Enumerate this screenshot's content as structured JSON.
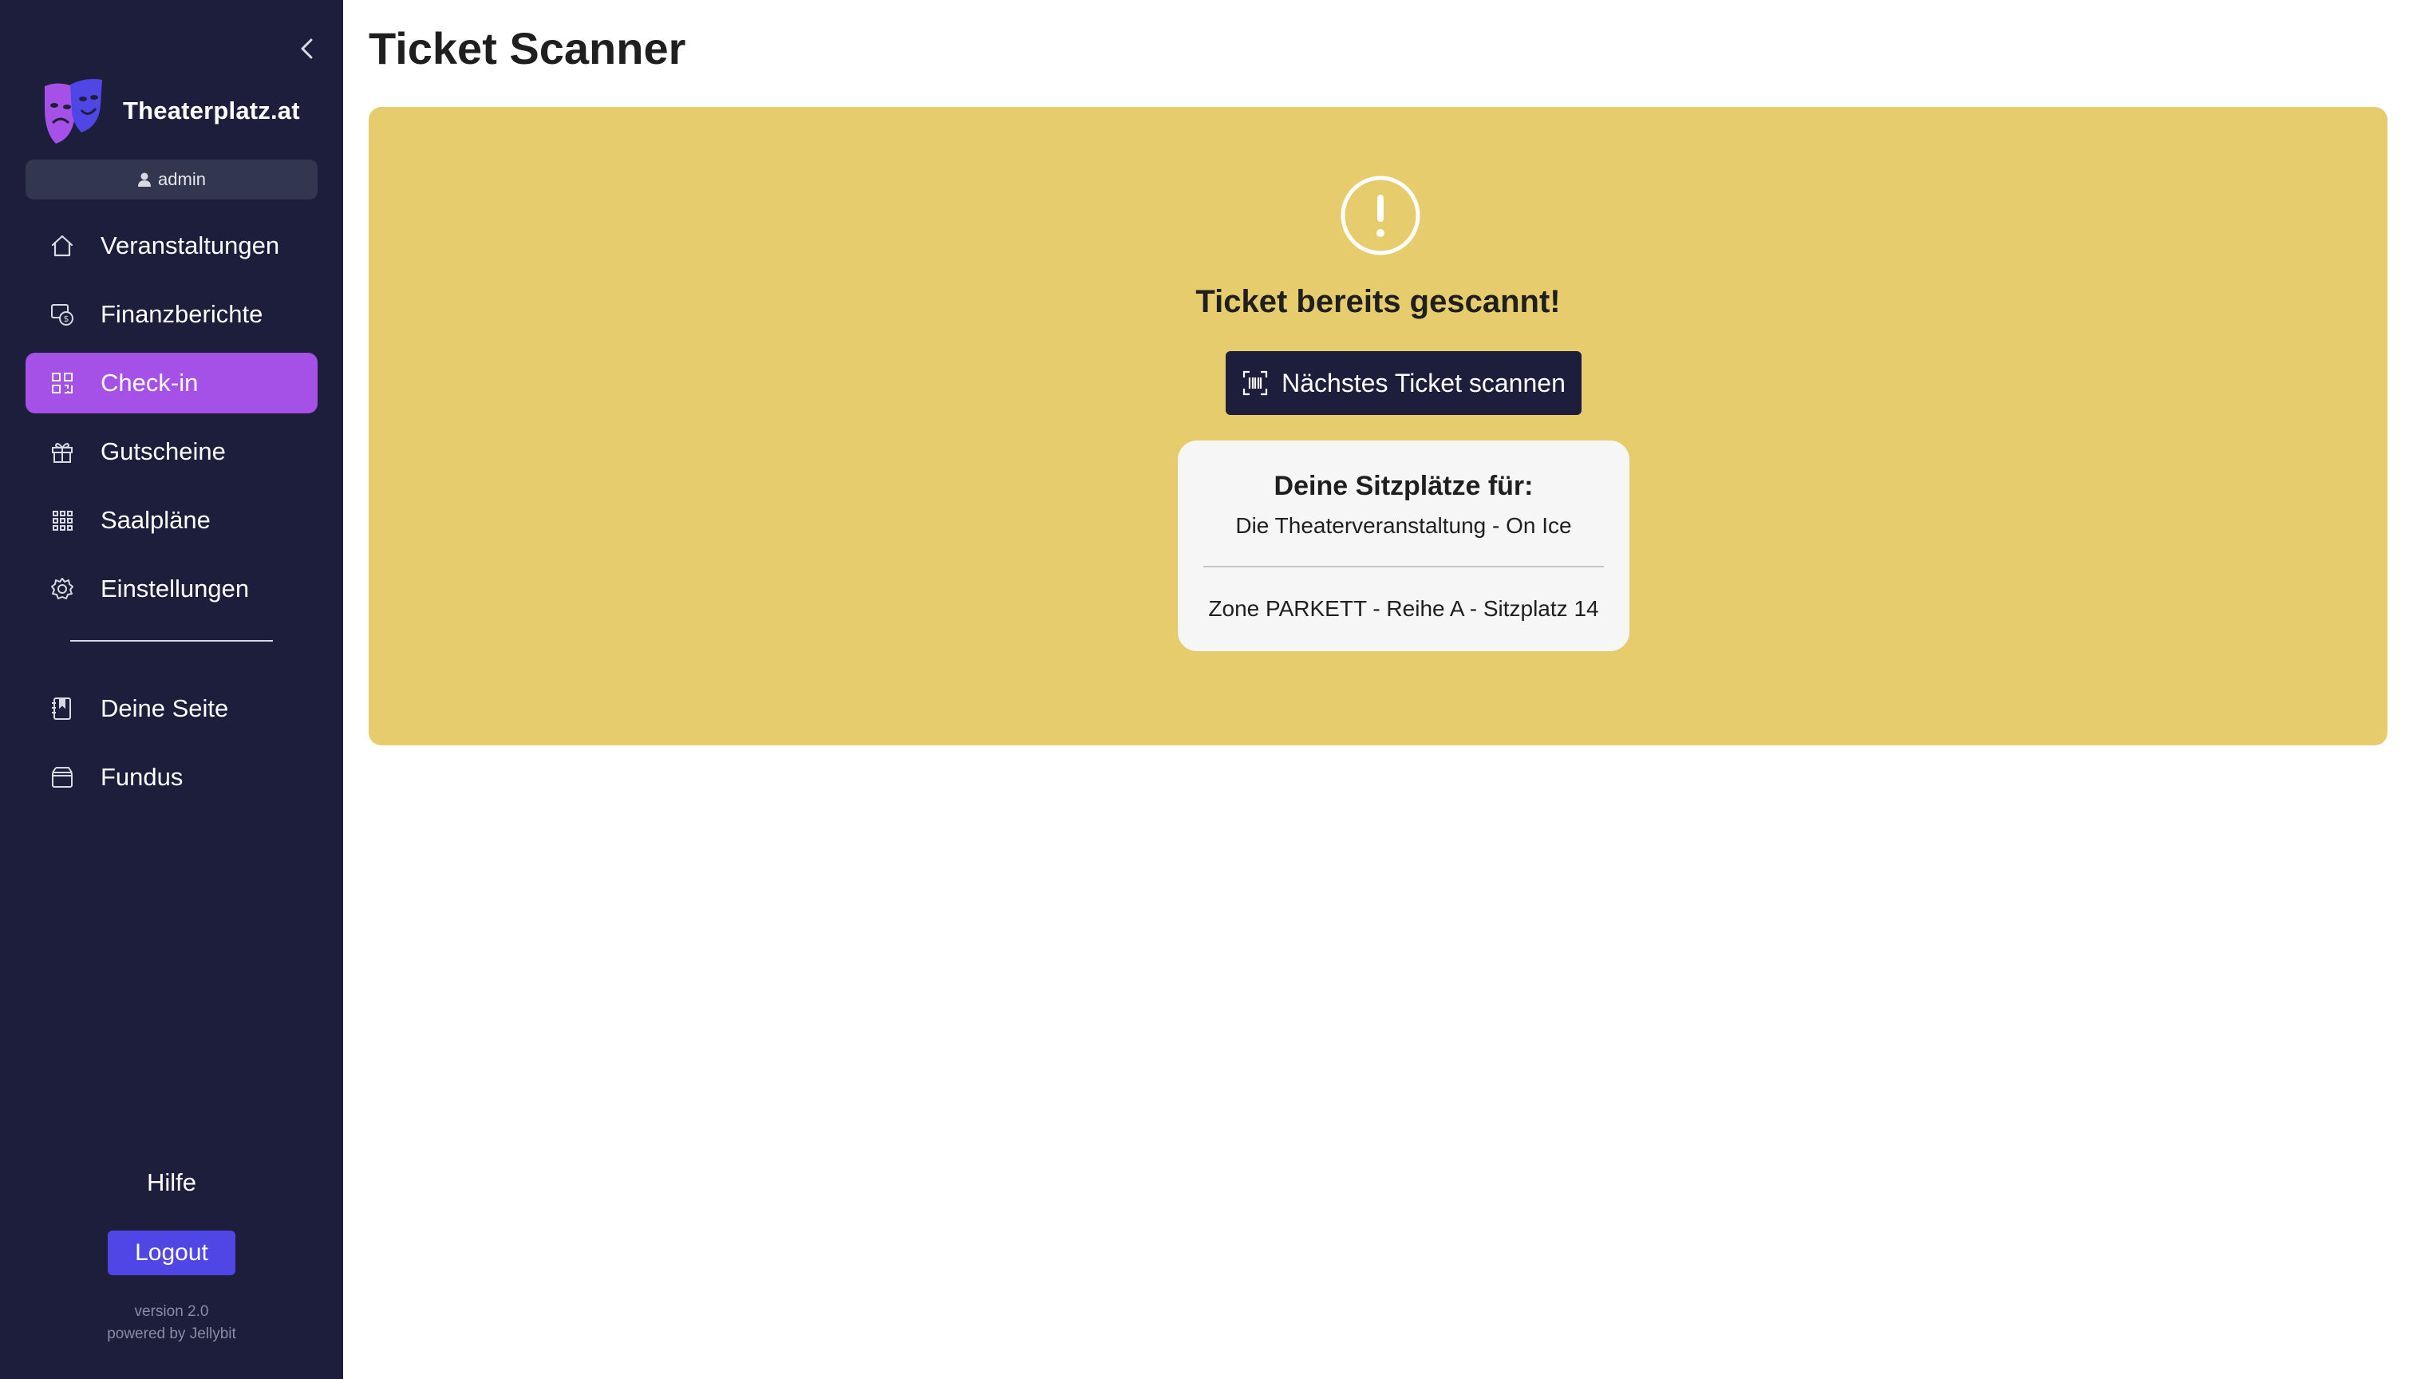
{
  "sidebar": {
    "brand_name": "Theaterplatz.at",
    "user": "admin",
    "nav": [
      {
        "label": "Veranstaltungen",
        "icon": "home-icon",
        "active": false
      },
      {
        "label": "Finanzberichte",
        "icon": "finance-report-icon",
        "active": false
      },
      {
        "label": "Check-in",
        "icon": "qr-scan-icon",
        "active": true
      },
      {
        "label": "Gutscheine",
        "icon": "gift-icon",
        "active": false
      },
      {
        "label": "Saalpläne",
        "icon": "grid-icon",
        "active": false
      },
      {
        "label": "Einstellungen",
        "icon": "gear-icon",
        "active": false
      }
    ],
    "nav_secondary": [
      {
        "label": "Deine Seite",
        "icon": "page-icon"
      },
      {
        "label": "Fundus",
        "icon": "box-icon"
      }
    ],
    "help_label": "Hilfe",
    "logout_label": "Logout",
    "version": "version 2.0",
    "powered_by": "powered by Jellybit"
  },
  "main": {
    "title": "Ticket Scanner",
    "alert": {
      "title": "Ticket bereits gescannt!",
      "button_label": "Nächstes Ticket scannen",
      "seat_card": {
        "title": "Deine Sitzplätze für:",
        "event": "Die Theaterveranstaltung - On Ice",
        "seat": "Zone PARKETT - Reihe A - Sitzplatz 14"
      }
    }
  },
  "colors": {
    "sidebar_bg": "#1c1e3b",
    "active_nav": "#a550e6",
    "alert_bg": "#e7cc6e",
    "logout_btn": "#4f46e5",
    "logo_purple": "#a550e6",
    "logo_blue": "#4f46e5"
  }
}
